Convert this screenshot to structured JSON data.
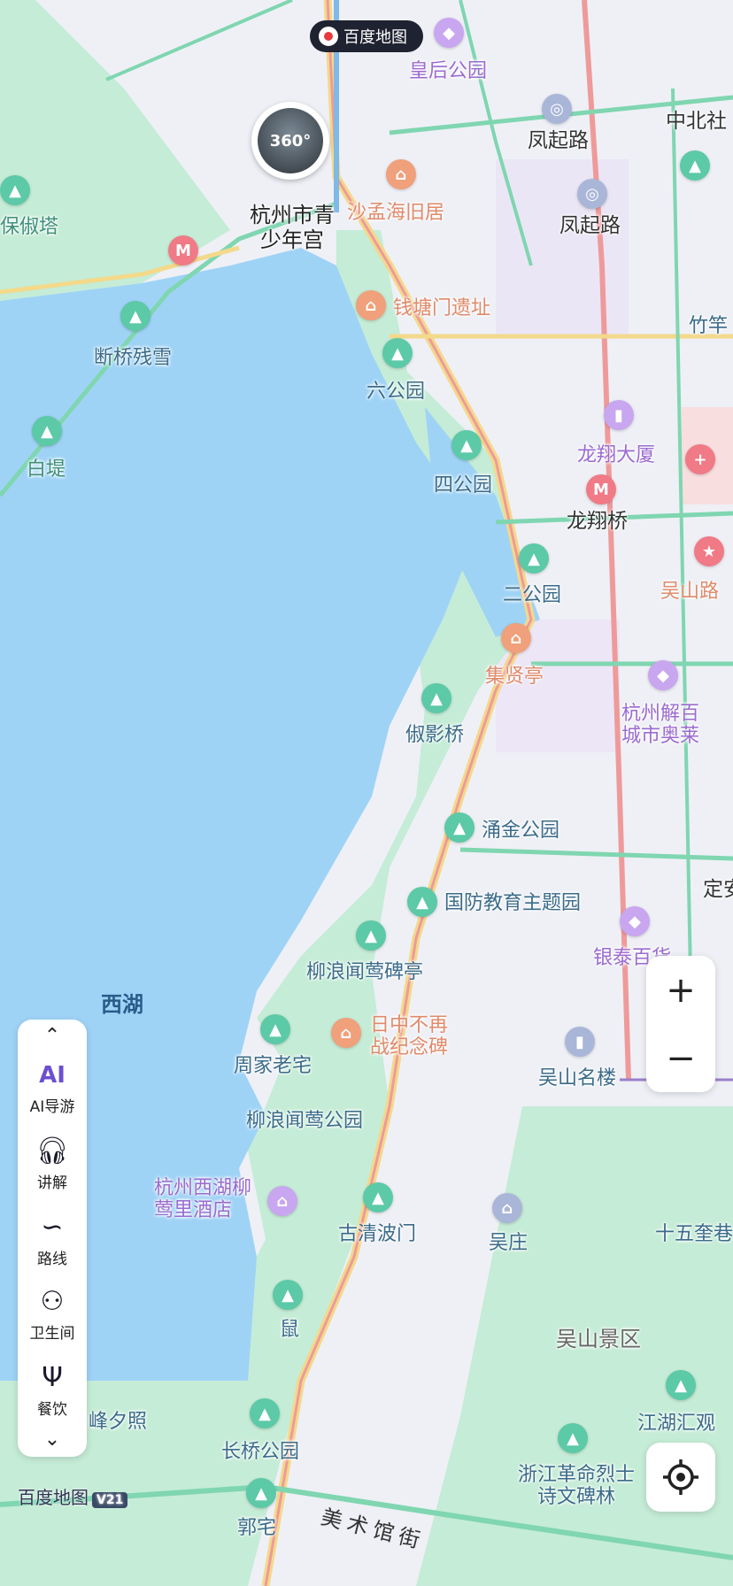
{
  "header": {
    "logo_text": "百度地图"
  },
  "pano": {
    "label": "360°"
  },
  "labels": {
    "huanghou_park": "皇后公园",
    "zhongbei": "中北社",
    "fengqi_road_1": "凤起路",
    "fengqi_road_2": "凤起路",
    "youth_palace": "杭州市青少年宫",
    "shameng": "沙孟海旧居",
    "baochu": "保俶塔",
    "duanqiao": "断桥残雪",
    "qiantang": "钱塘门遗址",
    "zhujian": "竹竿",
    "liupark": "六公园",
    "baidi": "白堤",
    "longxiang_tower": "龙翔大厦",
    "sipark": "四公园",
    "longxiang_bridge": "龙翔桥",
    "wushan_road": "吴山路",
    "erpark": "二公园",
    "jixianting": "集贤亭",
    "jiebai": "杭州解百城市奥莱",
    "niyingqiao": "俶影桥",
    "yongjin": "涌金公园",
    "dingan": "定安",
    "guofang": "国防教育主题园",
    "yintai": "银泰百货",
    "liulang_pavilion": "柳浪闻莺碑亭",
    "xihu": "西湖",
    "rizhong": "日中不再战纪念碑",
    "zhoujia": "周家老宅",
    "wushan_tower": "吴山名楼",
    "liulang_park": "柳浪闻莺公园",
    "hotel": "杭州西湖柳莺里酒店",
    "qingbo": "古清波门",
    "wuzhuang": "吴庄",
    "shiwu": "十五奎巷",
    "lu": "鼠",
    "wushan_scenic": "吴山景区",
    "leifeng": "峰夕照",
    "jianghu": "江湖汇观",
    "changqiao": "长桥公园",
    "martyrs": "浙江革命烈士诗文碑林",
    "guozhai": "郭宅",
    "meishu_street": "美术馆街"
  },
  "toolbar": {
    "items": [
      {
        "label": "AI导游",
        "icon": "ai-guide-icon"
      },
      {
        "label": "讲解",
        "icon": "headphones-icon"
      },
      {
        "label": "路线",
        "icon": "route-icon"
      },
      {
        "label": "卫生间",
        "icon": "restroom-icon"
      },
      {
        "label": "餐饮",
        "icon": "dining-icon"
      }
    ]
  },
  "zoom": {
    "in": "+",
    "out": "−"
  },
  "brand": {
    "name": "百度地图",
    "version": "V21"
  },
  "colors": {
    "water": "#9fd3f6",
    "green": "#c5ecd6",
    "road_green": "#7fd6b0",
    "road_yellow": "#f3d98a",
    "road_red": "#ef9a9a"
  }
}
